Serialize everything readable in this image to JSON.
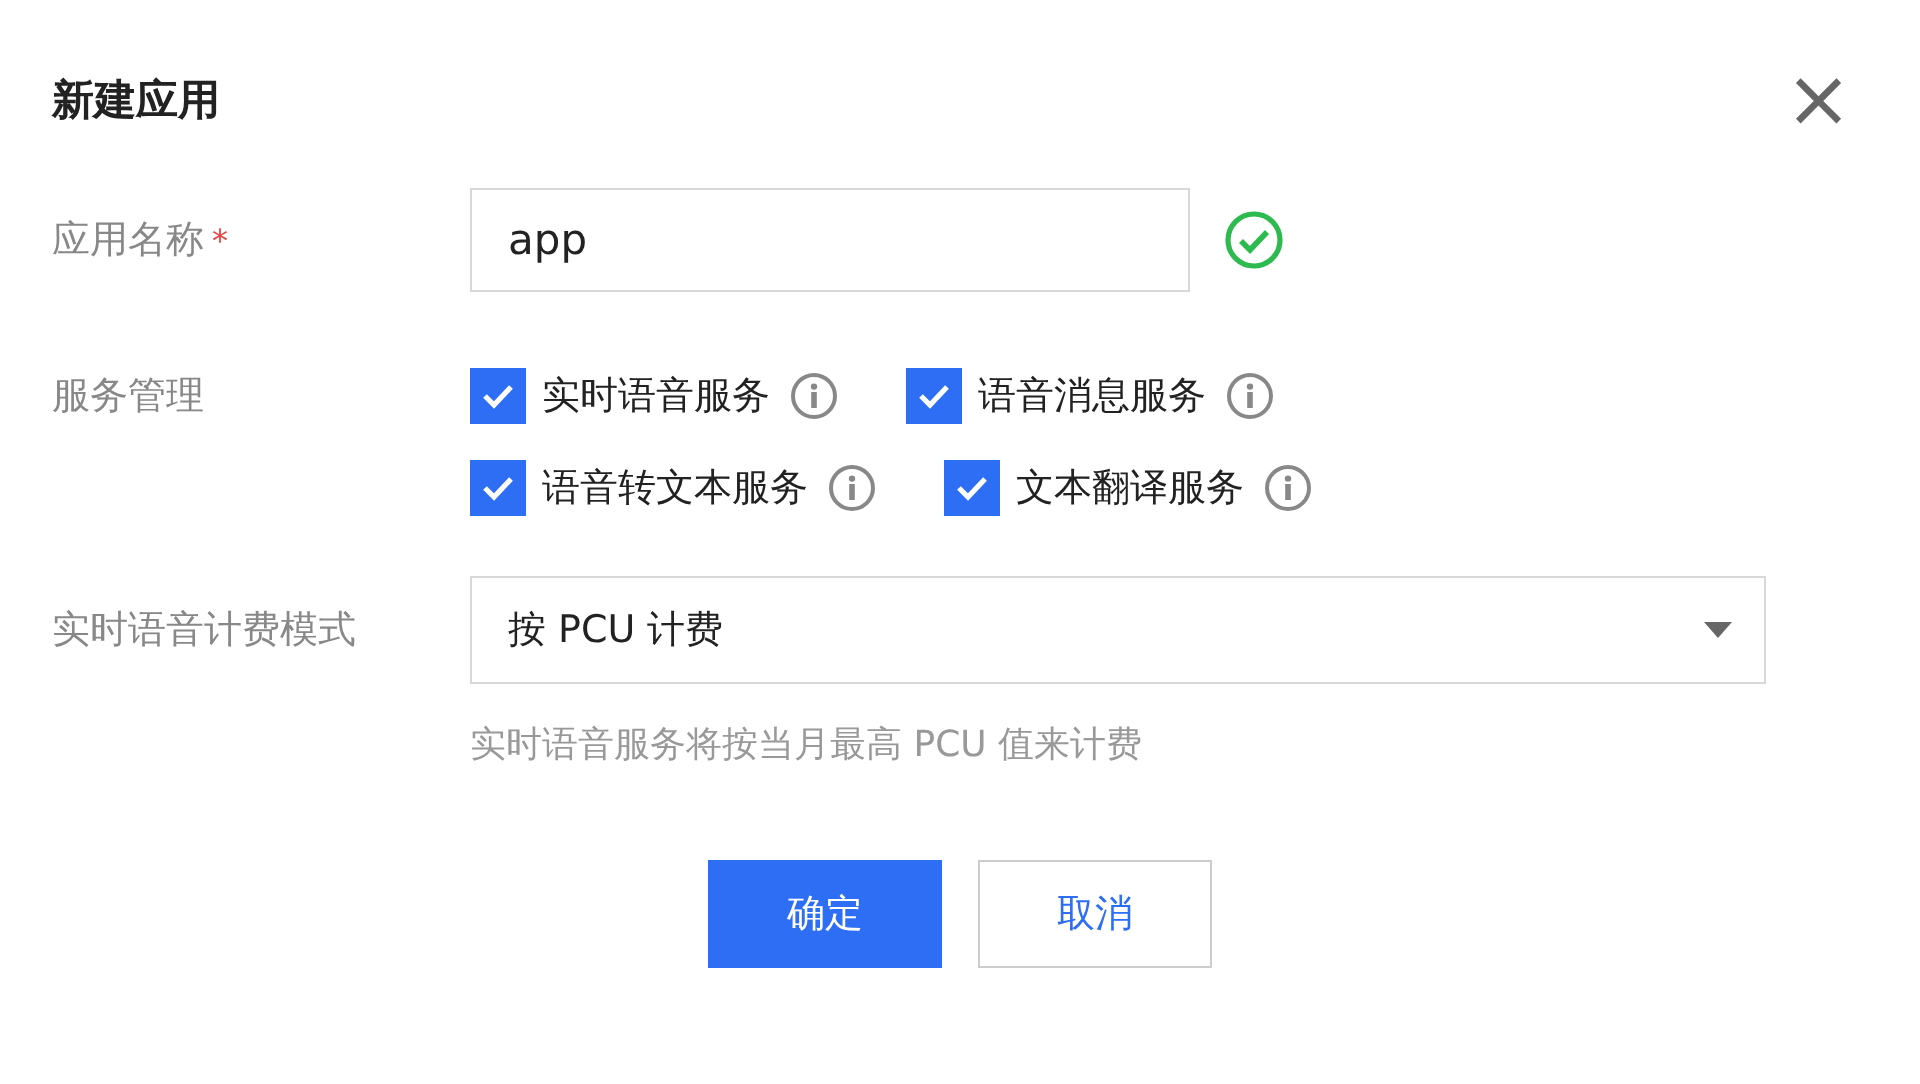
{
  "dialog": {
    "title": "新建应用",
    "close": "×"
  },
  "app_name": {
    "label": "应用名称",
    "required": true,
    "required_mark": "*",
    "value": "app",
    "valid": true
  },
  "services": {
    "label": "服务管理",
    "items": [
      {
        "label": "实时语音服务",
        "checked": true
      },
      {
        "label": "语音消息服务",
        "checked": true
      },
      {
        "label": "语音转文本服务",
        "checked": true
      },
      {
        "label": "文本翻译服务",
        "checked": true
      }
    ]
  },
  "billing": {
    "label": "实时语音计费模式",
    "value": "按 PCU 计费",
    "hint": "实时语音服务将按当月最高 PCU 值来计费"
  },
  "buttons": [
    {
      "label": "确定",
      "kind": "primary"
    },
    {
      "label": "取消",
      "kind": "secondary"
    }
  ]
}
